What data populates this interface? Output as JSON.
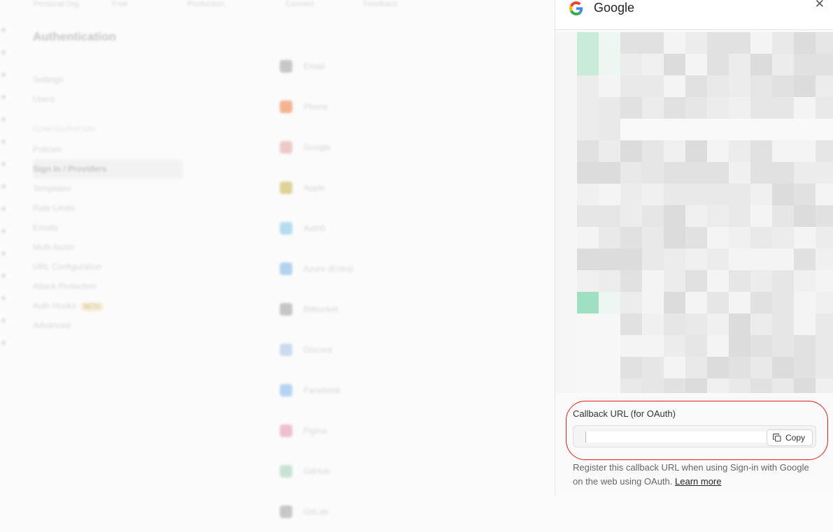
{
  "background": {
    "title": "Authentication",
    "topbar": [
      "Personal Org",
      "Free",
      "Production",
      "Connect",
      "Feedback"
    ],
    "nav": [
      "Settings",
      "Users",
      "CONFIGURATION",
      "Policies",
      "Sign In / Providers",
      "Templates",
      "Rate Limits",
      "Emails",
      "Multi-factor",
      "URL Configuration",
      "Attack Protection",
      "Auth Hooks",
      "Advanced"
    ],
    "nav_badge": "BETA",
    "providers": [
      "Email",
      "Phone",
      "Google",
      "Apple",
      "Auth0",
      "Azure (Entra)",
      "Bitbucket",
      "Discord",
      "Facebook",
      "Figma",
      "GitHub",
      "GitLab"
    ],
    "provider_colors": [
      "#9e9e9e",
      "#f07a3d",
      "#e0a3a3",
      "#c8b14a",
      "#7cc6e6",
      "#7ab3e8",
      "#9a9a9a",
      "#a6c0e6",
      "#7fb5ec",
      "#e58fa8",
      "#9fd0b8"
    ]
  },
  "panel": {
    "title": "Google",
    "logo_icon": "google-g-icon",
    "close_icon": "close-icon",
    "callback": {
      "label": "Callback URL (for OAuth)",
      "value": "",
      "copy_label": "Copy",
      "help_text": "Register this callback URL when using Sign-in with Google on the web using OAuth.",
      "learn_more": "Learn more"
    }
  },
  "colors": {
    "accent_red_outline": "#e02020",
    "mosaic_green": "#c8ecd9",
    "mosaic_green_dark": "#9fe0c2"
  }
}
